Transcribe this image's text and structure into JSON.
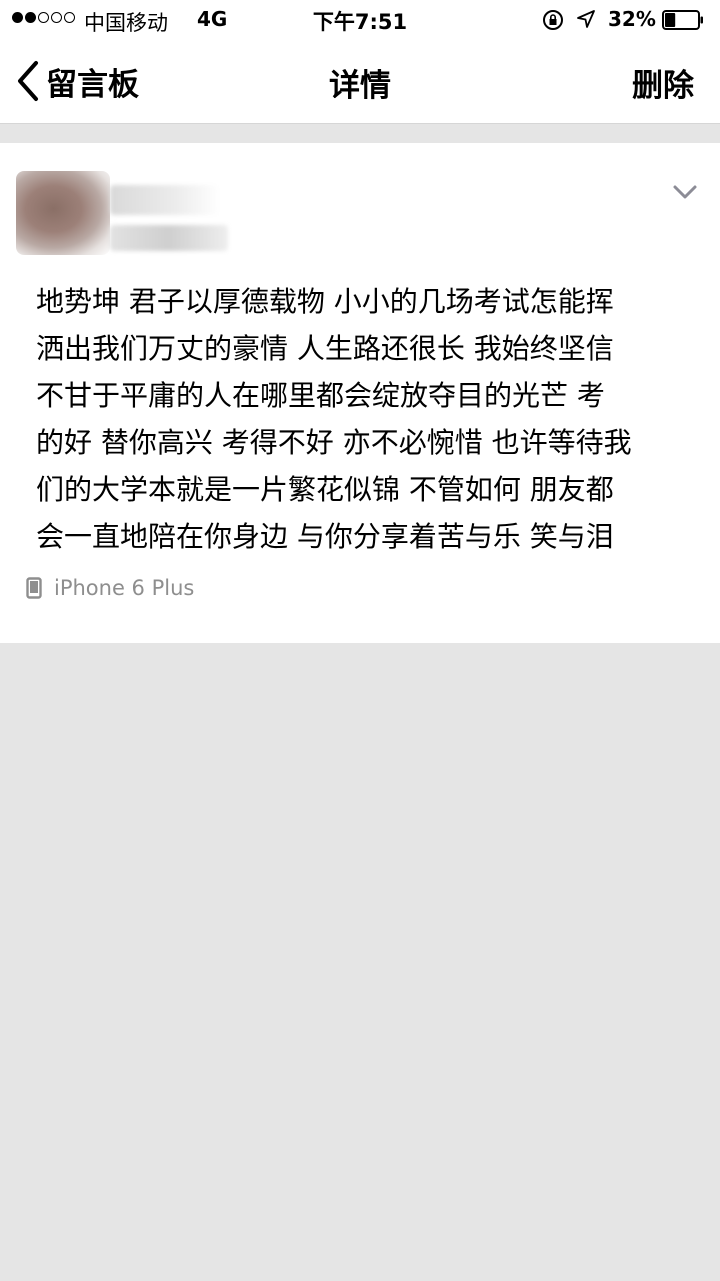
{
  "status_bar": {
    "signal_filled": 2,
    "signal_total": 5,
    "carrier": "中国移动",
    "network": "4G",
    "time": "下午7:51",
    "battery_percent_label": "32%",
    "battery_level": 0.32,
    "icons": [
      "orientation-lock-icon",
      "location-arrow-icon",
      "battery-icon"
    ]
  },
  "nav": {
    "back_label": "留言板",
    "title": "详情",
    "delete_label": "删除"
  },
  "post": {
    "lines": [
      "地势坤 君子以厚德载物 小小的几场考试怎能挥",
      "洒出我们万丈的豪情 人生路还很长 我始终坚信",
      "不甘于平庸的人在哪里都会绽放夺目的光芒 考",
      "的好 替你高兴 考得不好 亦不必惋惜 也许等待我",
      "们的大学本就是一片繁花似锦 不管如何 朋友都",
      "会一直地陪在你身边 与你分享着苦与乐 笑与泪"
    ],
    "device": "iPhone 6 Plus"
  },
  "colors": {
    "page_background": "#e5e5e5",
    "card_background": "#ffffff",
    "secondary_text": "#8e8e8e",
    "chevron": "#8c8c96"
  }
}
